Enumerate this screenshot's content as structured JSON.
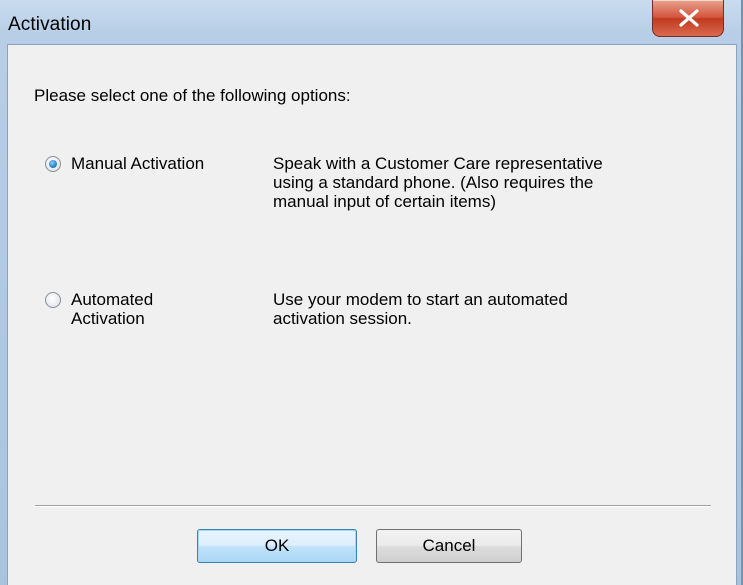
{
  "window": {
    "title": "Activation",
    "close_glyph": "X"
  },
  "prompt": "Please select one of the following options:",
  "options": [
    {
      "label_lines": [
        "Manual Activation"
      ],
      "selected": true,
      "description_lines": [
        "Speak with a Customer Care representative",
        "using a standard phone.  (Also requires the",
        "manual input of certain items)"
      ]
    },
    {
      "label_lines": [
        "Automated",
        "Activation"
      ],
      "selected": false,
      "description_lines": [
        "Use your modem to start an automated",
        "activation session."
      ]
    }
  ],
  "buttons": {
    "ok": "OK",
    "cancel": "Cancel"
  },
  "colors": {
    "accent": "#3c7fb1",
    "close_button": "#c13a20"
  }
}
